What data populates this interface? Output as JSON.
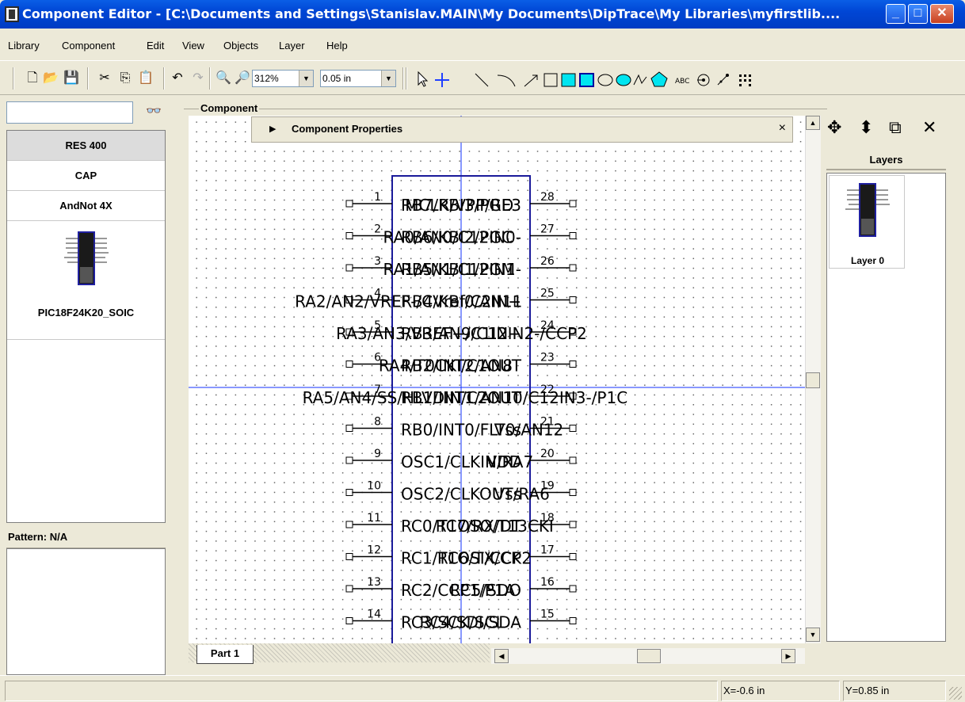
{
  "window": {
    "title": "Component Editor - [C:\\Documents and Settings\\Stanislav.MAIN\\My Documents\\DipTrace\\My Libraries\\myfirstlib....",
    "minimize": "_",
    "maximize": "□",
    "close": "✕"
  },
  "menu": [
    "Library",
    "Component",
    "Edit",
    "View",
    "Objects",
    "Layer",
    "Help"
  ],
  "toolbar": {
    "zoom_value": "312%",
    "grid_value": "0.05 in",
    "text_tool": "ABC"
  },
  "library": {
    "search_value": "",
    "components": [
      "RES 400",
      "CAP",
      "AndNot 4X"
    ],
    "selected_component": "RES 400",
    "preview_name": "PIC18F24K20_SOIC",
    "pattern_label": "Pattern: N/A"
  },
  "editor": {
    "group_label": "Component",
    "properties_title": "Component Properties",
    "properties_close": "×",
    "part_tab": "Part 1",
    "pins_left": [
      {
        "num": "1",
        "label": "RB7/KBI3/PGD"
      },
      {
        "num": "2",
        "label": "RB6/KBI2/PGC"
      },
      {
        "num": "3",
        "label": "RB5/KBI1/PGM"
      },
      {
        "num": "4",
        "label": "RB4/KBI0/AN11"
      },
      {
        "num": "5",
        "label": "RB3/AN9/C12IN2-/CCP2"
      },
      {
        "num": "6",
        "label": "RB2/INT2/AN8"
      },
      {
        "num": "7",
        "label": "RB1/INT1/AN10/C12IN3-/P1C"
      },
      {
        "num": "8",
        "label": "RB0/INT0/FLT0/AN12"
      },
      {
        "num": "9",
        "label": "OSC1/CLKIN/RA7"
      },
      {
        "num": "10",
        "label": "OSC2/CLKOUT/RA6"
      },
      {
        "num": "11",
        "label": "RC0/T1OSO/T13CKI"
      },
      {
        "num": "12",
        "label": "RC1/T1OSI/CCP2"
      },
      {
        "num": "13",
        "label": "RC2/CCP1/P1A"
      },
      {
        "num": "14",
        "label": "RC3/SCK/SCL"
      }
    ],
    "pins_right": [
      {
        "num": "28",
        "label": "MCLR/VPP/RE3"
      },
      {
        "num": "27",
        "label": "RA0/AN0/C12IN0-"
      },
      {
        "num": "26",
        "label": "RA1/AN1/C12IN1-"
      },
      {
        "num": "25",
        "label": "RA2/AN2/VREF-/CVref/C2IN+"
      },
      {
        "num": "24",
        "label": "RA3/AN3/VREF+/C1IN+"
      },
      {
        "num": "23",
        "label": "RA4/T0CKI/C1OUT"
      },
      {
        "num": "22",
        "label": "RA5/AN4/SS/HLVDIN/C2OUT"
      },
      {
        "num": "21",
        "label": "Vss"
      },
      {
        "num": "20",
        "label": "VDD"
      },
      {
        "num": "19",
        "label": "Vss"
      },
      {
        "num": "18",
        "label": "RC7/RX/DT"
      },
      {
        "num": "17",
        "label": "RC6/TX/CK"
      },
      {
        "num": "16",
        "label": "RC5/SDO"
      },
      {
        "num": "15",
        "label": "RC4/SDI/SDA"
      }
    ]
  },
  "layers": {
    "header": "Layers",
    "items": [
      "Layer 0"
    ]
  },
  "status": {
    "x": "X=-0.6 in",
    "y": "Y=0.85 in"
  }
}
